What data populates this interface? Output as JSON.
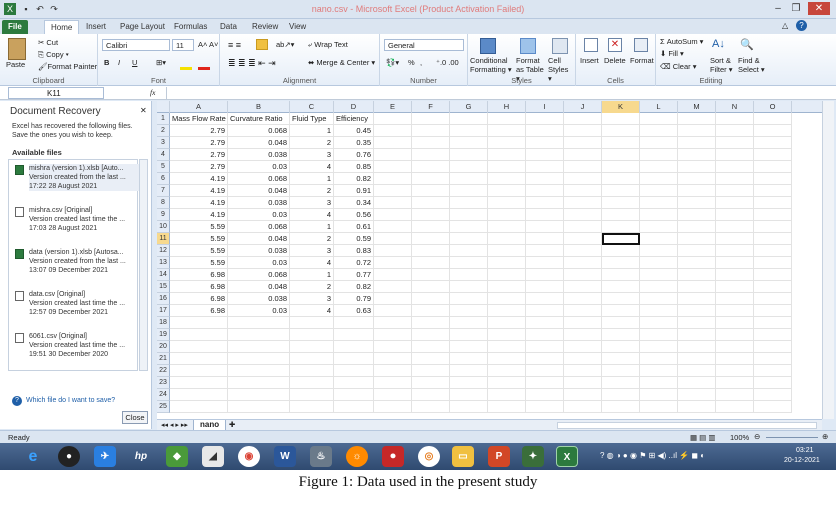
{
  "window": {
    "title": "nano.csv - Microsoft Excel (Product Activation Failed)"
  },
  "tabs": [
    "File",
    "Home",
    "Insert",
    "Page Layout",
    "Formulas",
    "Data",
    "Review",
    "View"
  ],
  "ribbon": {
    "clipboard": {
      "label": "Clipboard",
      "paste": "Paste",
      "cut": "Cut",
      "copy": "Copy ▾",
      "format_painter": "Format Painter"
    },
    "font": {
      "label": "Font",
      "name": "Calibri",
      "size": "11",
      "bold": "B",
      "italic": "I",
      "underline": "U"
    },
    "alignment": {
      "label": "Alignment",
      "wrap": "Wrap Text",
      "merge": "Merge & Center ▾"
    },
    "number": {
      "label": "Number",
      "format": "General",
      "percent": "%",
      "comma": ","
    },
    "styles": {
      "label": "Styles",
      "conditional": "Conditional Formatting ▾",
      "format_table": "Format as Table ▾",
      "cell_styles": "Cell Styles ▾"
    },
    "cells": {
      "label": "Cells",
      "insert": "Insert",
      "delete": "Delete",
      "format": "Format"
    },
    "editing": {
      "label": "Editing",
      "autosum": "Σ AutoSum ▾",
      "fill": "Fill ▾",
      "clear": "Clear ▾",
      "sort": "Sort & Filter ▾",
      "find": "Find & Select ▾"
    }
  },
  "formula_bar": {
    "cell_ref": "K11",
    "fx": "fx",
    "value": ""
  },
  "recovery": {
    "title": "Document Recovery",
    "description": "Excel has recovered the following files.  Save the ones you wish to keep.",
    "subtitle": "Available files",
    "files": [
      {
        "name": "mishra (version 1).xlsb  [Auto...",
        "note": "Version created from the last ...",
        "time": "17:22 28 August 2021",
        "icon": "excel-icon"
      },
      {
        "name": "mishra.csv  [Original]",
        "note": "Version created last time the ...",
        "time": "17:03 28 August 2021",
        "icon": "file-icon"
      },
      {
        "name": "data (version 1).xlsb  [Autosa...",
        "note": "Version created from the last ...",
        "time": "13:07 09 December 2021",
        "icon": "excel-icon"
      },
      {
        "name": "data.csv  [Original]",
        "note": "Version created last time the ...",
        "time": "12:57 09 December 2021",
        "icon": "file-icon"
      },
      {
        "name": "6061.csv  [Original]",
        "note": "Version created last time the ...",
        "time": "19:51 30 December 2020",
        "icon": "file-icon"
      }
    ],
    "help": "Which file do I want to save?",
    "close": "Close"
  },
  "sheet": {
    "columns": [
      "A",
      "B",
      "C",
      "D",
      "E",
      "F",
      "G",
      "H",
      "I",
      "J",
      "K",
      "L",
      "M",
      "N",
      "O"
    ],
    "headers": [
      "Mass Flow Rate",
      "Curvature Ratio",
      "Fluid Type",
      "Efficiency"
    ],
    "rows": [
      [
        "2.79",
        "0.068",
        "1",
        "0.45"
      ],
      [
        "2.79",
        "0.048",
        "2",
        "0.35"
      ],
      [
        "2.79",
        "0.038",
        "3",
        "0.76"
      ],
      [
        "2.79",
        "0.03",
        "4",
        "0.85"
      ],
      [
        "4.19",
        "0.068",
        "1",
        "0.82"
      ],
      [
        "4.19",
        "0.048",
        "2",
        "0.91"
      ],
      [
        "4.19",
        "0.038",
        "3",
        "0.34"
      ],
      [
        "4.19",
        "0.03",
        "4",
        "0.56"
      ],
      [
        "5.59",
        "0.068",
        "1",
        "0.61"
      ],
      [
        "5.59",
        "0.048",
        "2",
        "0.59"
      ],
      [
        "5.59",
        "0.038",
        "3",
        "0.83"
      ],
      [
        "5.59",
        "0.03",
        "4",
        "0.72"
      ],
      [
        "6.98",
        "0.068",
        "1",
        "0.77"
      ],
      [
        "6.98",
        "0.048",
        "2",
        "0.82"
      ],
      [
        "6.98",
        "0.038",
        "3",
        "0.79"
      ],
      [
        "6.98",
        "0.03",
        "4",
        "0.63"
      ]
    ],
    "row_count": 25,
    "sheet_tab": "nano",
    "selected_cell": "K11"
  },
  "status": {
    "ready": "Ready",
    "zoom": "100%"
  },
  "taskbar": {
    "time": "03:21",
    "date": "20-12-2021"
  },
  "caption": "Figure 1: Data used in the present study"
}
